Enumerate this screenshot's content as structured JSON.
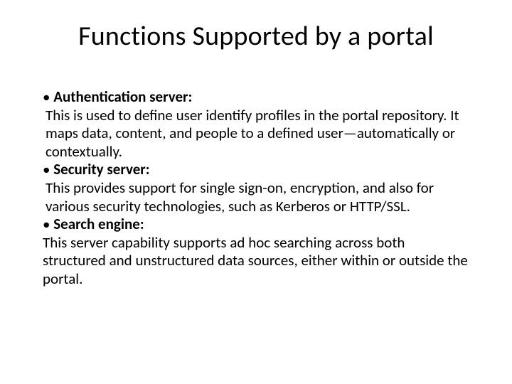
{
  "title": "Functions Supported by a portal",
  "sections": [
    {
      "bullet": "• ",
      "heading": "Authentication server:",
      "text": " This is used to define user identify profiles in the portal repository. It maps data, content, and people to a defined user—automatically or contextually."
    },
    {
      "bullet": "• ",
      "heading": "Security server:",
      "text": " This provides support for single sign-on, encryption, and also for various security technologies, such as Kerberos or HTTP/SSL."
    },
    {
      "bullet": "• ",
      "heading": "Search engine:",
      "text": "This server capability supports ad hoc searching across both structured and unstructured data sources, either within or outside the portal."
    }
  ]
}
